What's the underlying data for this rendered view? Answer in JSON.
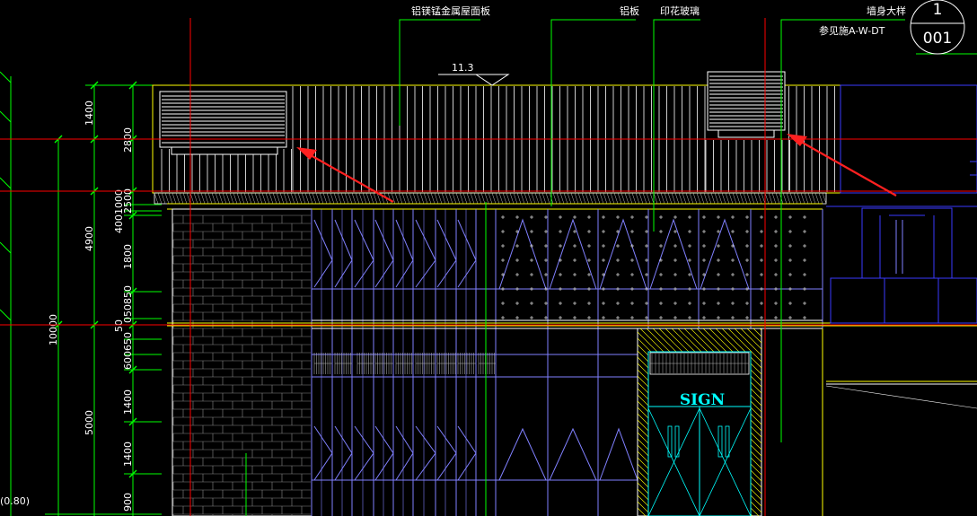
{
  "annotations": {
    "roof_panel": "铝镁锰金属屋面板",
    "aluminum_panel": "铝板",
    "printed_glass": "印花玻璃",
    "wall_detail": "墙身大样",
    "reference": "参见施A-W-DT"
  },
  "detail_tag": {
    "top": "1",
    "bottom": "001"
  },
  "elevation_mark": "11.3",
  "sign_text": "SIGN",
  "coordinate": "(0.80)",
  "dimensions": {
    "left_total": "10000",
    "left_split": [
      "4900",
      "5000"
    ],
    "inner": [
      "1400",
      "2800",
      "4001000",
      "2500",
      "1800",
      "050850",
      "50",
      "600650",
      "1400",
      "1400",
      "900"
    ]
  },
  "colors": {
    "background": "#000000",
    "structure": "#ffff00",
    "glazing": "#8080ff",
    "dimension": "#00ff00",
    "axis": "#ff0000",
    "highlight": "#00ffff",
    "arrow": "#ff2020",
    "text": "#ffffff"
  }
}
